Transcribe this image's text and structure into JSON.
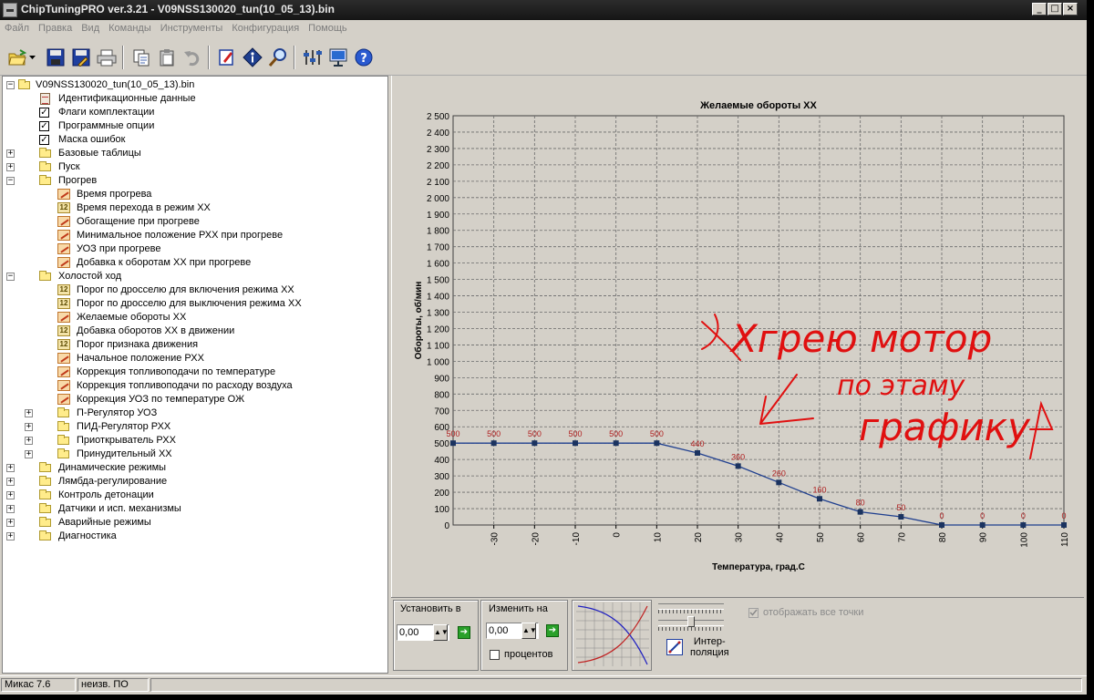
{
  "window": {
    "title": "ChipTuningPRO ver.3.21 - V09NSS130020_tun(10_05_13).bin",
    "min_label": "_",
    "max_label": "□",
    "close_label": "×"
  },
  "menu": [
    "Файл",
    "Правка",
    "Вид",
    "Команды",
    "Инструменты",
    "Конфигурация",
    "Помощь"
  ],
  "toolbar_icons": [
    "open-icon",
    "dropdown-arrow-icon",
    "save-icon",
    "save-as-icon",
    "print-icon",
    "copy-icon",
    "paste-icon",
    "undo-icon",
    "edit-icon",
    "info-icon",
    "search-icon",
    "settings-icon",
    "connect-icon",
    "help-icon"
  ],
  "tree": {
    "root": "V09NSS130020_tun(10_05_13).bin",
    "nodes": [
      {
        "label": "Идентификационные данные",
        "icon": "doc",
        "level": 1,
        "exp": ""
      },
      {
        "label": "Флаги комплектации",
        "icon": "check",
        "level": 1,
        "exp": ""
      },
      {
        "label": "Программные опции",
        "icon": "check",
        "level": 1,
        "exp": ""
      },
      {
        "label": "Маска ошибок",
        "icon": "check",
        "level": 1,
        "exp": ""
      },
      {
        "label": "Базовые таблицы",
        "icon": "folder",
        "level": 1,
        "exp": "+"
      },
      {
        "label": "Пуск",
        "icon": "folder",
        "level": 1,
        "exp": "+"
      },
      {
        "label": "Прогрев",
        "icon": "folder-open",
        "level": 1,
        "exp": "−"
      },
      {
        "label": "Время прогрева",
        "icon": "graph",
        "level": 2,
        "exp": ""
      },
      {
        "label": "Время перехода в режим ХХ",
        "icon": "num",
        "level": 2,
        "exp": ""
      },
      {
        "label": "Обогащение при прогреве",
        "icon": "graph",
        "level": 2,
        "exp": ""
      },
      {
        "label": "Минимальное положение РХХ при прогреве",
        "icon": "graph",
        "level": 2,
        "exp": ""
      },
      {
        "label": "УОЗ при прогреве",
        "icon": "graph",
        "level": 2,
        "exp": ""
      },
      {
        "label": "Добавка к оборотам ХХ при прогреве",
        "icon": "graph",
        "level": 2,
        "exp": ""
      },
      {
        "label": "Холостой ход",
        "icon": "folder-open",
        "level": 1,
        "exp": "−"
      },
      {
        "label": "Порог по дросселю для включения режима ХХ",
        "icon": "num",
        "level": 2,
        "exp": ""
      },
      {
        "label": "Порог по дросселю для выключения режима ХХ",
        "icon": "num",
        "level": 2,
        "exp": ""
      },
      {
        "label": "Желаемые обороты ХХ",
        "icon": "graph",
        "level": 2,
        "exp": ""
      },
      {
        "label": "Добавка оборотов ХХ в движении",
        "icon": "num",
        "level": 2,
        "exp": ""
      },
      {
        "label": "Порог признака движения",
        "icon": "num",
        "level": 2,
        "exp": ""
      },
      {
        "label": "Начальное положение РХХ",
        "icon": "graph",
        "level": 2,
        "exp": ""
      },
      {
        "label": "Коррекция топливоподачи по температуре",
        "icon": "graph",
        "level": 2,
        "exp": ""
      },
      {
        "label": "Коррекция топливоподачи по расходу воздуха",
        "icon": "graph",
        "level": 2,
        "exp": ""
      },
      {
        "label": "Коррекция УОЗ по температуре ОЖ",
        "icon": "graph",
        "level": 2,
        "exp": ""
      },
      {
        "label": "П-Регулятор УОЗ",
        "icon": "folder",
        "level": 2,
        "exp": "+"
      },
      {
        "label": "ПИД-Регулятор РХХ",
        "icon": "folder",
        "level": 2,
        "exp": "+"
      },
      {
        "label": "Приоткрыватель РХХ",
        "icon": "folder",
        "level": 2,
        "exp": "+"
      },
      {
        "label": "Принудительный ХХ",
        "icon": "folder",
        "level": 2,
        "exp": "+"
      },
      {
        "label": "Динамические режимы",
        "icon": "folder",
        "level": 1,
        "exp": "+"
      },
      {
        "label": "Лямбда-регулирование",
        "icon": "folder",
        "level": 1,
        "exp": "+"
      },
      {
        "label": "Контроль детонации",
        "icon": "folder",
        "level": 1,
        "exp": "+"
      },
      {
        "label": "Датчики и исп. механизмы",
        "icon": "folder",
        "level": 1,
        "exp": "+"
      },
      {
        "label": "Аварийные режимы",
        "icon": "folder",
        "level": 1,
        "exp": "+"
      },
      {
        "label": "Диагностика",
        "icon": "folder",
        "level": 1,
        "exp": "+"
      }
    ]
  },
  "chart_data": {
    "type": "line",
    "title": "Желаемые обороты ХХ",
    "xlabel": "Температура, град.С",
    "ylabel": "Обороты, об/мин",
    "x": [
      -40,
      -30,
      -20,
      -10,
      0,
      10,
      20,
      30,
      40,
      50,
      60,
      70,
      80,
      90,
      100,
      110
    ],
    "values": [
      500,
      500,
      500,
      500,
      500,
      500,
      440,
      360,
      260,
      160,
      80,
      50,
      0,
      0,
      0,
      0
    ],
    "point_labels": [
      "500",
      "500",
      "500",
      "500",
      "500",
      "500",
      "440",
      "360",
      "260",
      "160",
      "80",
      "50",
      "0",
      "0",
      "0",
      "0"
    ],
    "x_ticks": [
      "-30",
      "-20",
      "-10",
      "0",
      "10",
      "20",
      "30",
      "40",
      "50",
      "60",
      "70",
      "80",
      "90",
      "100",
      "110"
    ],
    "y_ticks": [
      "0",
      "100",
      "200",
      "300",
      "400",
      "500",
      "600",
      "700",
      "800",
      "900",
      "1 000",
      "1 100",
      "1 200",
      "1 300",
      "1 400",
      "1 500",
      "1 600",
      "1 700",
      "1 800",
      "1 900",
      "2 000",
      "2 100",
      "2 200",
      "2 300",
      "2 400",
      "2 500"
    ],
    "ylim": [
      0,
      2500
    ],
    "xlim": [
      -40,
      110
    ],
    "grid": true,
    "line_color": "#1f3f8f",
    "marker_color": "#1b3360",
    "label_color": "#b02020"
  },
  "annotation": {
    "line1": "Хгрею мотор",
    "line2": "по этаму",
    "line3": "графику",
    "color": "#e01010"
  },
  "controls": {
    "set_label": "Установить в",
    "set_value": "0,00",
    "change_label": "Изменить на",
    "change_value": "0,00",
    "percent_label": "процентов",
    "interp_label_1": "Интер-",
    "interp_label_2": "поляция",
    "show_all_label": "отображать все точки"
  },
  "status": {
    "left": "Микас 7.6",
    "right": "неизв. ПО"
  }
}
